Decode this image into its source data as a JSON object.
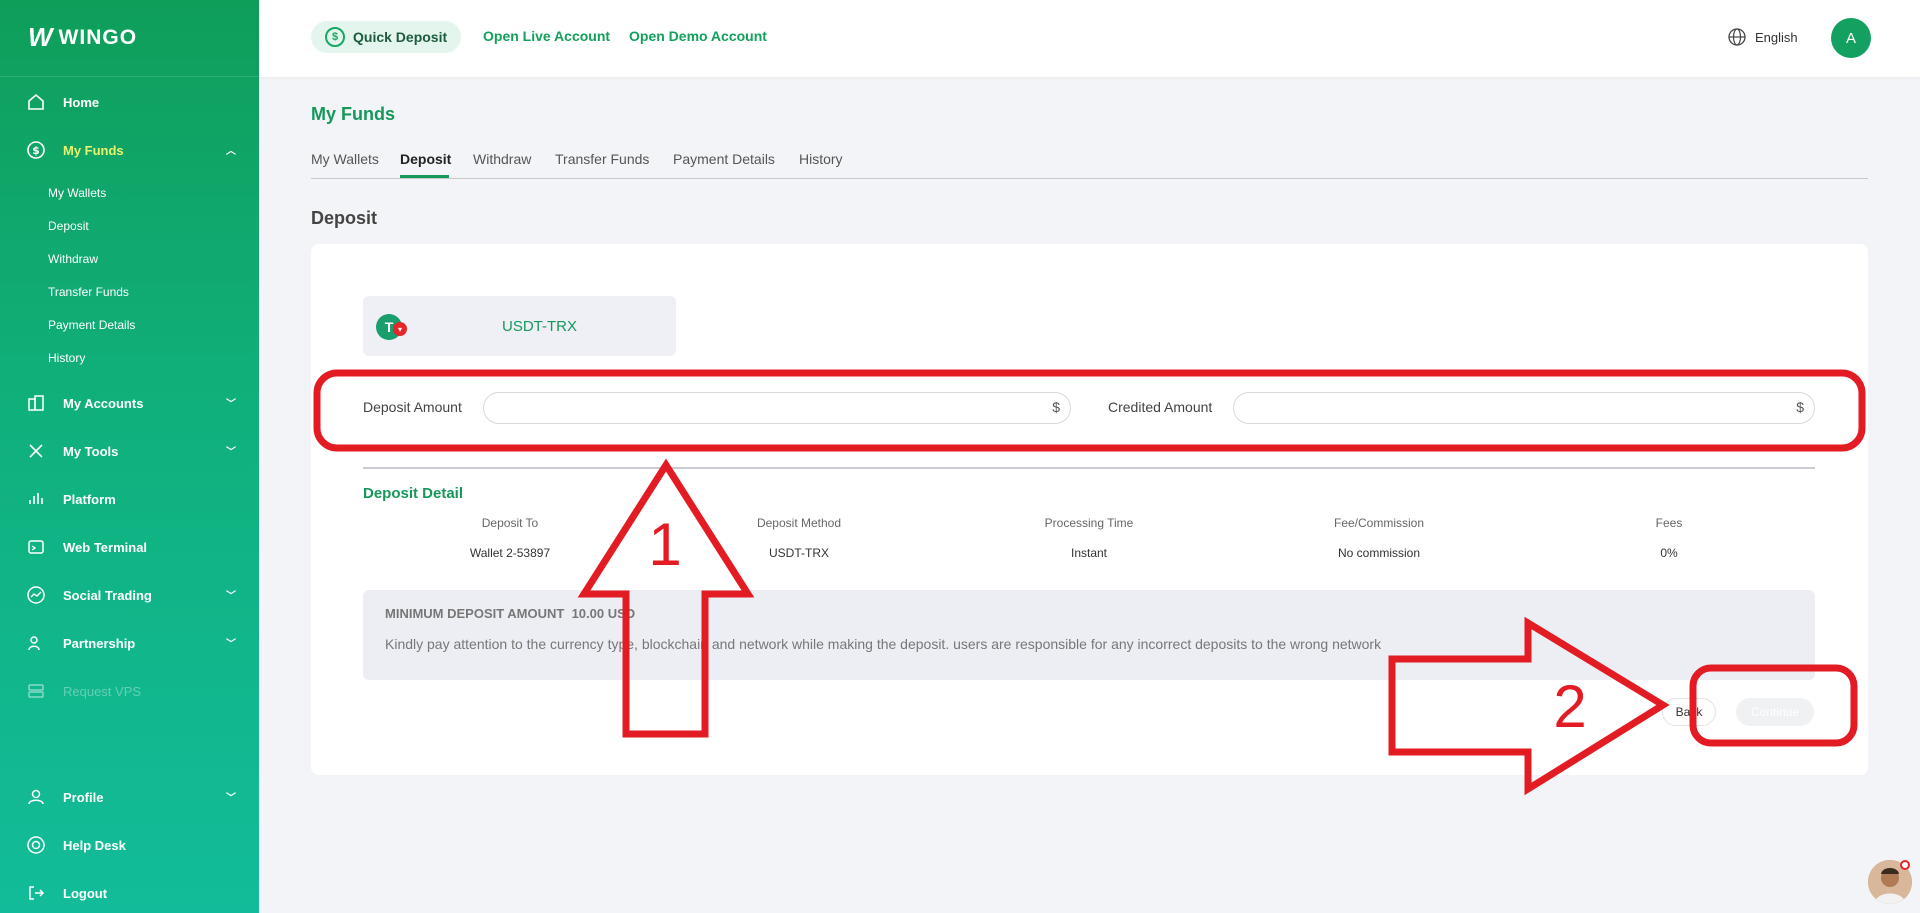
{
  "brand": {
    "name": "WINGO",
    "mark": "W"
  },
  "sidebar": {
    "items": [
      {
        "label": "Home",
        "icon": "home-icon"
      },
      {
        "label": "My Funds",
        "icon": "dollar-circle-icon",
        "active": true,
        "subitems": [
          "My Wallets",
          "Deposit",
          "Withdraw",
          "Transfer Funds",
          "Payment Details",
          "History"
        ]
      },
      {
        "label": "My Accounts",
        "icon": "building-icon"
      },
      {
        "label": "My Tools",
        "icon": "tools-icon"
      },
      {
        "label": "Platform",
        "icon": "bars-icon"
      },
      {
        "label": "Web Terminal",
        "icon": "terminal-icon"
      },
      {
        "label": "Social Trading",
        "icon": "chart-icon"
      },
      {
        "label": "Partnership",
        "icon": "partners-icon"
      },
      {
        "label": "Request VPS",
        "icon": "server-icon",
        "disabled": true
      },
      {
        "label": "Profile",
        "icon": "user-icon"
      },
      {
        "label": "Help Desk",
        "icon": "lifebuoy-icon"
      },
      {
        "label": "Logout",
        "icon": "logout-icon"
      }
    ]
  },
  "header": {
    "quick_deposit": "Quick Deposit",
    "open_live": "Open Live Account",
    "open_demo": "Open Demo Account",
    "language": "English",
    "avatar_initial": "A"
  },
  "main": {
    "title": "My Funds",
    "tabs": [
      "My Wallets",
      "Deposit",
      "Withdraw",
      "Transfer Funds",
      "Payment Details",
      "History"
    ],
    "active_tab": "Deposit",
    "section_title": "Deposit",
    "method": "USDT-TRX",
    "deposit_amount_label": "Deposit Amount",
    "credited_amount_label": "Credited Amount",
    "currency_symbol": "$",
    "deposit_amount_value": "",
    "credited_amount_value": "",
    "detail": {
      "title": "Deposit Detail",
      "columns": [
        {
          "header": "Deposit To",
          "value": "Wallet 2-53897"
        },
        {
          "header": "Deposit Method",
          "value": "USDT-TRX"
        },
        {
          "header": "Processing Time",
          "value": "Instant"
        },
        {
          "header": "Fee/Commission",
          "value": "No commission"
        },
        {
          "header": "Fees",
          "value": "0%"
        }
      ]
    },
    "notice": {
      "title": "MINIMUM DEPOSIT AMOUNT  10.00 USD",
      "text": "Kindly pay attention to the currency type, blockchain and network while making the deposit. users are responsible for any incorrect deposits to the wrong network"
    },
    "back_label": "Back",
    "continue_label": "Continue"
  },
  "annotations": {
    "label_1": "1",
    "label_2": "2",
    "color": "#e31b23"
  }
}
